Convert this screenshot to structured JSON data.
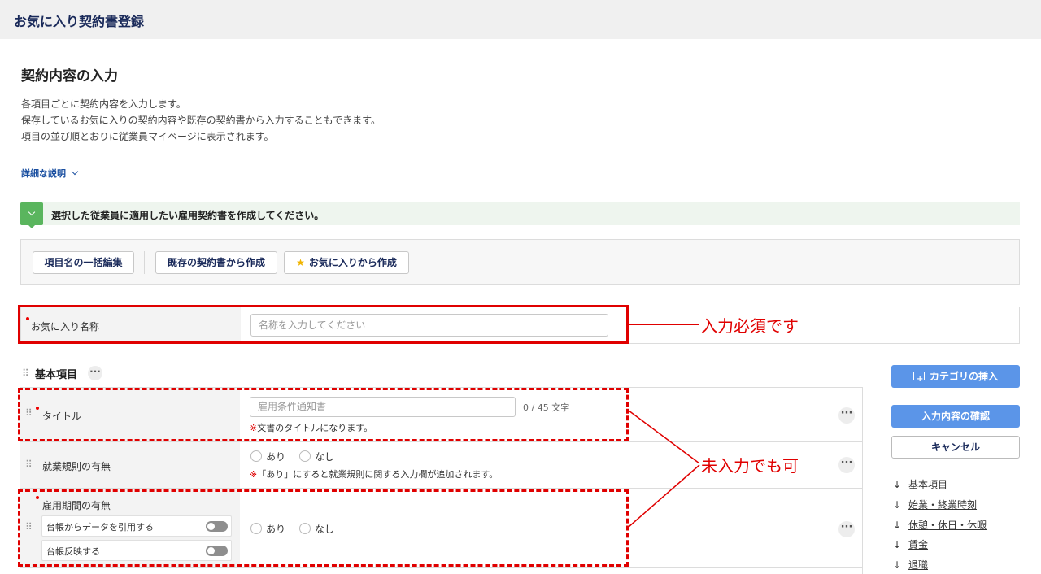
{
  "header": {
    "title": "お気に入り契約書登録"
  },
  "section": {
    "title": "契約内容の入力",
    "description": [
      "各項目ごとに契約内容を入力します。",
      "保存しているお気に入りの契約内容や既存の契約書から入力することもできます。",
      "項目の並び順とおりに従業員マイページに表示されます。"
    ],
    "detail_link": "詳細な説明"
  },
  "notice": {
    "text": "選択した従業員に適用したい雇用契約書を作成してください。"
  },
  "toolbar": {
    "bulk_edit": "項目名の一括編集",
    "from_existing": "既存の契約書から作成",
    "from_favorite": "お気に入りから作成"
  },
  "favorite_name": {
    "label": "お気に入り名称",
    "placeholder": "名称を入力してください",
    "annotation": "入力必須です"
  },
  "group": {
    "title": "基本項目",
    "annotation": "未入力でも可"
  },
  "rows": {
    "title": {
      "label": "タイトル",
      "placeholder": "雇用条件通知書",
      "counter": "0 / 45 文字",
      "hint_mark": "※",
      "hint": "文書のタイトルになります。"
    },
    "work_rules": {
      "label": "就業規則の有無",
      "option_yes": "あり",
      "option_no": "なし",
      "hint_mark": "※",
      "hint": "「あり」にすると就業規則に関する入力欄が追加されます。"
    },
    "employment_period": {
      "label": "雇用期間の有無",
      "toggle_cite": "台帳からデータを引用する",
      "toggle_reflect": "台帳反映する",
      "option_yes": "あり",
      "option_no": "なし"
    }
  },
  "sidebar": {
    "insert_category": "カテゴリの挿入",
    "confirm": "入力内容の確認",
    "cancel": "キャンセル",
    "nav": [
      "基本項目",
      "始業・終業時刻",
      "休憩・休日・休暇",
      "賃金",
      "退職"
    ]
  },
  "colors": {
    "accent_blue": "#5b95e8",
    "annotation_red": "#e00000",
    "notice_green": "#5ab55e"
  }
}
